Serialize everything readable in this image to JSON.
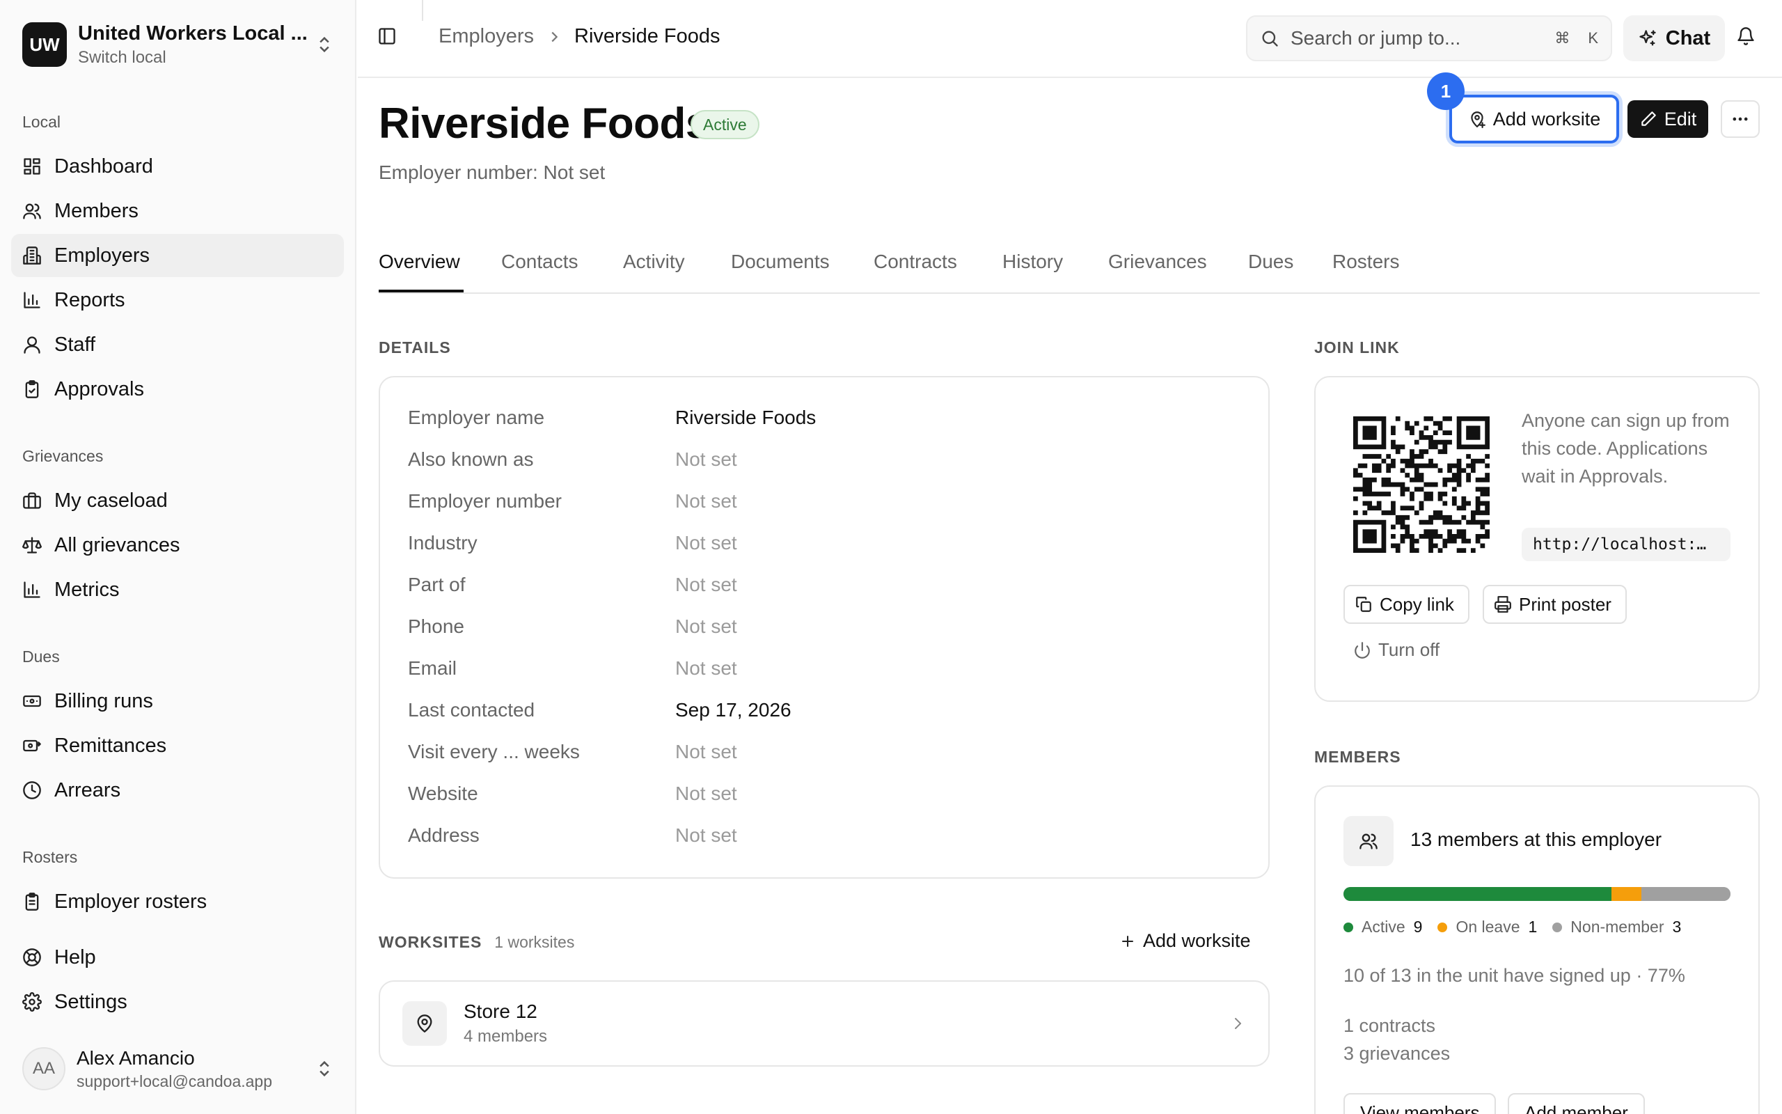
{
  "org": {
    "initials": "UW",
    "name": "United Workers Local ...",
    "switch_label": "Switch local"
  },
  "sidebar": {
    "section_local": "Local",
    "local_items": [
      {
        "label": "Dashboard",
        "icon": "dashboard-icon"
      },
      {
        "label": "Members",
        "icon": "users-icon"
      },
      {
        "label": "Employers",
        "icon": "building-icon"
      },
      {
        "label": "Reports",
        "icon": "bar-chart-icon"
      },
      {
        "label": "Staff",
        "icon": "user-icon"
      },
      {
        "label": "Approvals",
        "icon": "clipboard-check-icon"
      }
    ],
    "section_grievances": "Grievances",
    "grievance_items": [
      {
        "label": "My caseload",
        "icon": "briefcase-icon"
      },
      {
        "label": "All grievances",
        "icon": "scale-icon"
      },
      {
        "label": "Metrics",
        "icon": "bar-chart-icon"
      }
    ],
    "section_dues": "Dues",
    "dues_items": [
      {
        "label": "Billing runs",
        "icon": "banknote-icon"
      },
      {
        "label": "Remittances",
        "icon": "money-send-icon"
      },
      {
        "label": "Arrears",
        "icon": "clock-icon"
      }
    ],
    "section_rosters": "Rosters",
    "roster_items": [
      {
        "label": "Employer rosters",
        "icon": "clipboard-list-icon"
      }
    ],
    "help_label": "Help",
    "settings_label": "Settings",
    "active_item": "Employers"
  },
  "user": {
    "initials": "AA",
    "name": "Alex Amancio",
    "email": "support+local@candoa.app"
  },
  "topbar": {
    "breadcrumb_parent": "Employers",
    "breadcrumb_current": "Riverside Foods",
    "search_placeholder": "Search or jump to...",
    "shortcut_cmd": "⌘",
    "shortcut_key": "K",
    "chat_label": "Chat"
  },
  "header": {
    "title": "Riverside Foods",
    "status": "Active",
    "subtitle": "Employer number: Not set",
    "add_worksite_label": "Add worksite",
    "step_number": "1",
    "edit_label": "Edit"
  },
  "tabs": [
    "Overview",
    "Contacts",
    "Activity",
    "Documents",
    "Contracts",
    "History",
    "Grievances",
    "Dues",
    "Rosters"
  ],
  "active_tab": "Overview",
  "details": {
    "section_label": "DETAILS",
    "rows": [
      {
        "label": "Employer name",
        "value": "Riverside Foods",
        "muted": false
      },
      {
        "label": "Also known as",
        "value": "Not set",
        "muted": true
      },
      {
        "label": "Employer number",
        "value": "Not set",
        "muted": true
      },
      {
        "label": "Industry",
        "value": "Not set",
        "muted": true
      },
      {
        "label": "Part of",
        "value": "Not set",
        "muted": true
      },
      {
        "label": "Phone",
        "value": "Not set",
        "muted": true
      },
      {
        "label": "Email",
        "value": "Not set",
        "muted": true
      },
      {
        "label": "Last contacted",
        "value": "Sep 17, 2026",
        "muted": false
      },
      {
        "label": "Visit every ... weeks",
        "value": "Not set",
        "muted": true
      },
      {
        "label": "Website",
        "value": "Not set",
        "muted": true
      },
      {
        "label": "Address",
        "value": "Not set",
        "muted": true
      }
    ]
  },
  "worksites": {
    "section_label": "WORKSITES",
    "count_label": "1 worksites",
    "add_label": "Add worksite",
    "items": [
      {
        "name": "Store 12",
        "members": "4 members"
      }
    ]
  },
  "join_link": {
    "section_label": "JOIN LINK",
    "description": "Anyone can sign up from this code. Applications wait in Approvals.",
    "url": "http://localhost:…",
    "copy_label": "Copy link",
    "print_label": "Print poster",
    "turn_off_label": "Turn off"
  },
  "members": {
    "section_label": "MEMBERS",
    "title": "13 members at this employer",
    "breakdown": [
      {
        "label": "Active",
        "count": 9,
        "color": "#1e8a3c"
      },
      {
        "label": "On leave",
        "count": 1,
        "color": "#f59e0b"
      },
      {
        "label": "Non-member",
        "count": 3,
        "color": "#a0a0a0"
      }
    ],
    "total": 13,
    "signed_up": "10 of 13 in the unit have signed up · 77%",
    "contracts": "1 contracts",
    "grievances": "3 grievances",
    "view_label": "View members",
    "add_label": "Add member"
  }
}
